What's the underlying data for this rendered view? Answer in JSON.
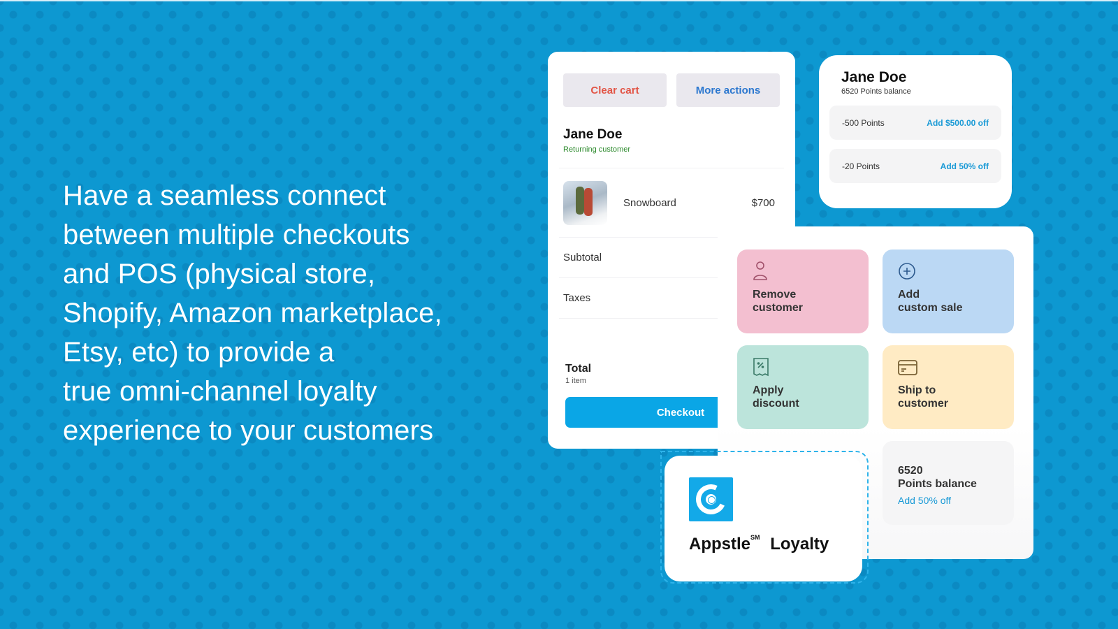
{
  "headline": {
    "lines": [
      "Have a seamless connect",
      "between multiple checkouts",
      "and POS (physical store,",
      "Shopify, Amazon marketplace,",
      "Etsy, etc) to provide a",
      "true omni-channel loyalty",
      "experience to your customers"
    ]
  },
  "cart": {
    "clear_label": "Clear cart",
    "more_label": "More actions",
    "customer_name": "Jane Doe",
    "customer_status": "Returning customer",
    "item": {
      "name": "Snowboard",
      "price": "$700"
    },
    "subtotal_label": "Subtotal",
    "taxes_label": "Taxes",
    "total_label": "Total",
    "total_sub": "1 item",
    "checkout_label": "Checkout"
  },
  "points_card": {
    "name": "Jane Doe",
    "balance": "6520 Points balance",
    "rewards": [
      {
        "points": "-500 Points",
        "action": "Add $500.00 off"
      },
      {
        "points": "-20 Points",
        "action": "Add 50% off"
      }
    ]
  },
  "actions": {
    "tiles": [
      {
        "line1": "Remove",
        "line2": "customer",
        "icon": "person-icon"
      },
      {
        "line1": "Add",
        "line2": "custom sale",
        "icon": "plus-circle-icon"
      },
      {
        "line1": "Apply",
        "line2": "discount",
        "icon": "discount-receipt-icon"
      },
      {
        "line1": "Ship to",
        "line2": "customer",
        "icon": "credit-card-icon"
      }
    ],
    "balance": {
      "number": "6520",
      "label": "Points balance",
      "action": "Add 50% off"
    }
  },
  "brand": {
    "name": "Appstle",
    "mark": "SM",
    "product": "Loyalty"
  },
  "colors": {
    "background": "#0d98d1",
    "accent": "#0aa6e6",
    "link": "#1a9ad6",
    "danger": "#e25546",
    "success": "#2c8a2c"
  }
}
